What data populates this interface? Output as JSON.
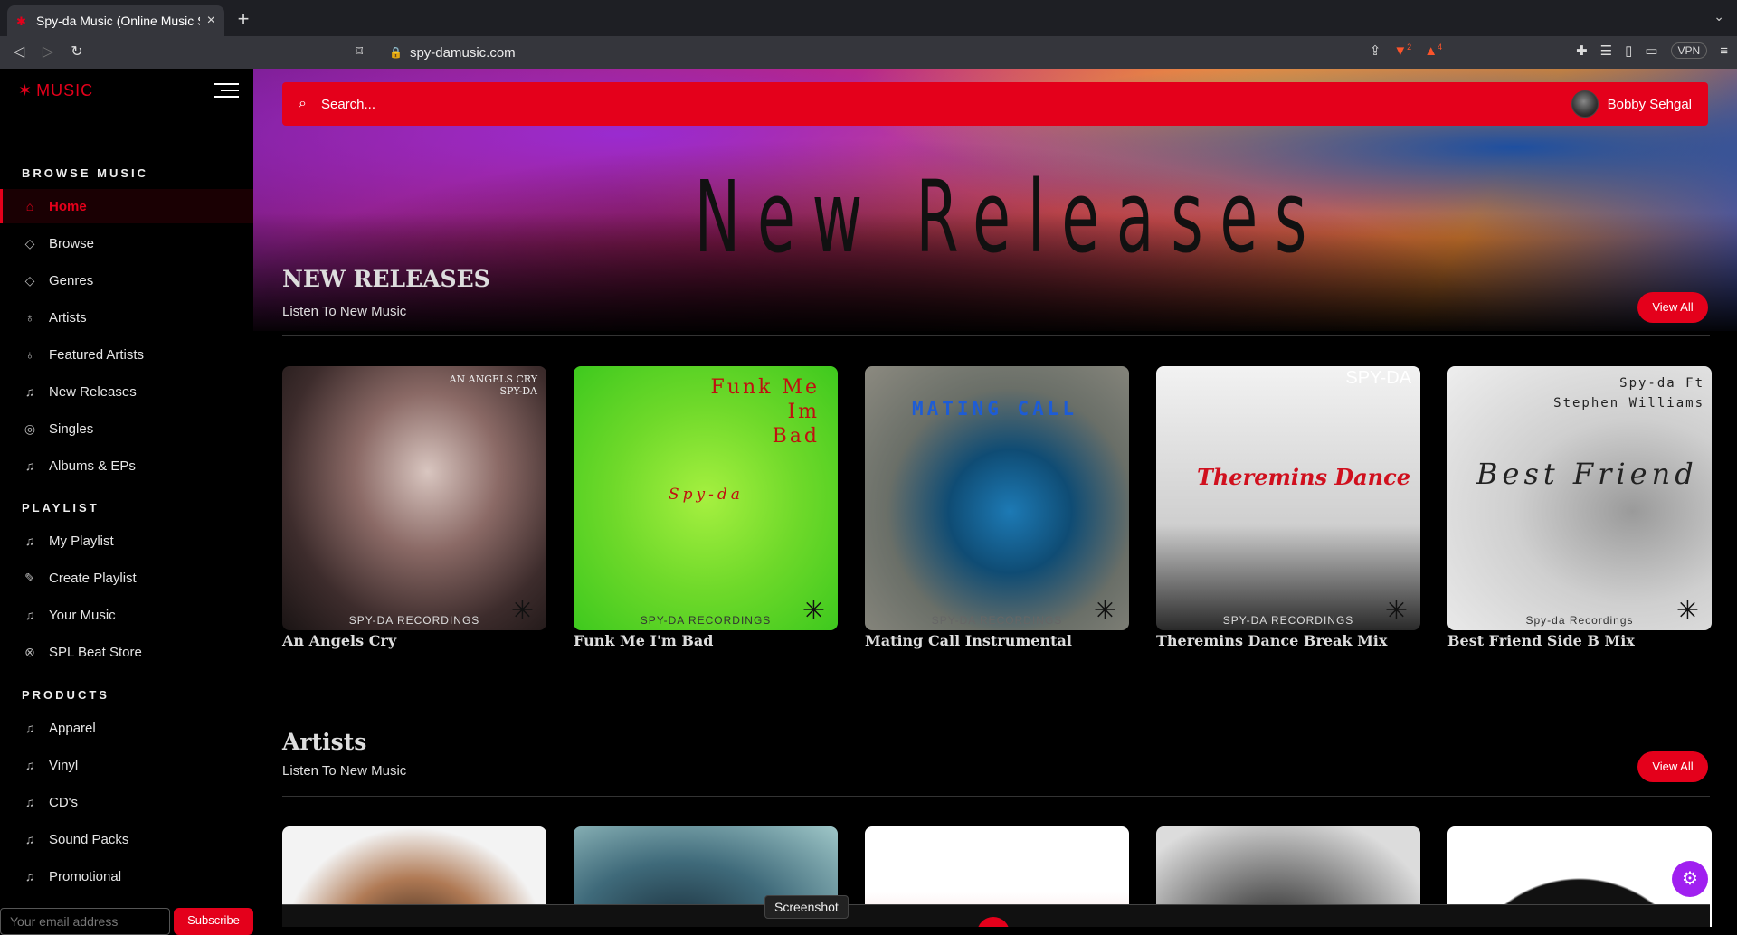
{
  "browser": {
    "tab_title": "Spy-da Music (Online Music Str",
    "url": "spy-damusic.com",
    "shield_count": "2",
    "rewards_count": "4",
    "vpn_label": "VPN"
  },
  "sidebar": {
    "logo_text": "MUSIC",
    "browse_heading": "BROWSE MUSIC",
    "browse_items": [
      {
        "label": "Home",
        "icon": "home-icon"
      },
      {
        "label": "Browse",
        "icon": "diamond-icon"
      },
      {
        "label": "Genres",
        "icon": "diamond-icon"
      },
      {
        "label": "Artists",
        "icon": "microphone-icon"
      },
      {
        "label": "Featured Artists",
        "icon": "microphone-icon"
      },
      {
        "label": "New Releases",
        "icon": "music-note-icon"
      },
      {
        "label": "Singles",
        "icon": "disc-icon"
      },
      {
        "label": "Albums & EPs",
        "icon": "music-note-icon"
      }
    ],
    "playlist_heading": "PLAYLIST",
    "playlist_items": [
      {
        "label": "My Playlist",
        "icon": "music-note-icon"
      },
      {
        "label": "Create Playlist",
        "icon": "edit-icon"
      },
      {
        "label": "Your Music",
        "icon": "music-note-icon"
      },
      {
        "label": "SPL Beat Store",
        "icon": "store-icon"
      }
    ],
    "products_heading": "PRODUCTS",
    "products_items": [
      {
        "label": "Apparel",
        "icon": "music-note-icon"
      },
      {
        "label": "Vinyl",
        "icon": "music-note-icon"
      },
      {
        "label": "CD's",
        "icon": "music-note-icon"
      },
      {
        "label": "Sound Packs",
        "icon": "music-note-icon"
      },
      {
        "label": "Promotional",
        "icon": "music-note-icon"
      }
    ],
    "email_placeholder": "Your email address",
    "subscribe_label": "Subscribe"
  },
  "header": {
    "search_placeholder": "Search...",
    "user_name": "Bobby Sehgal"
  },
  "hero": {
    "title": "New Releases"
  },
  "new_releases": {
    "title": "NEW RELEASES",
    "subtitle": "Listen To New Music",
    "view_all": "View All",
    "items": [
      {
        "title": "An Angels Cry",
        "cover_text": "AN ANGELS CRY\nSPY-DA",
        "label": "SPY-DA RECORDINGS"
      },
      {
        "title": "Funk Me I'm Bad",
        "cover_text": "Funk Me\nIm\nBad",
        "cover_sub": "Spy-da",
        "label": "SPY-DA RECORDINGS"
      },
      {
        "title": "Mating Call Instrumental",
        "cover_text": "MATING CALL",
        "label": "SPY-DA RECORDINGS"
      },
      {
        "title": "Theremins Dance Break Mix",
        "cover_text": "SPY-DA",
        "cover_sub": "Theremins Dance",
        "label": "SPY-DA RECORDINGS"
      },
      {
        "title": "Best Friend Side B Mix",
        "cover_text": "Spy-da Ft\nStephen Williams",
        "cover_sub": "Best Friend",
        "label": "Spy-da Recordings"
      }
    ]
  },
  "artists": {
    "title": "Artists",
    "subtitle": "Listen To New Music",
    "view_all": "View All"
  },
  "tooltip": "Screenshot",
  "colors": {
    "accent": "#e4001b",
    "settings_fab": "#a020f0"
  }
}
